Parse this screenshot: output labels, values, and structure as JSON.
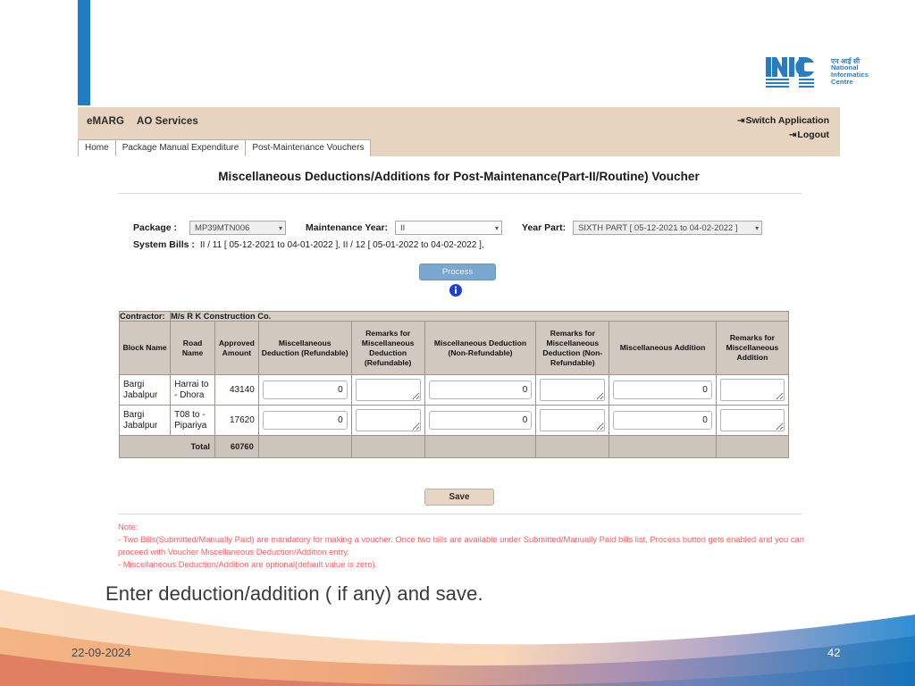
{
  "logo": {
    "mark": "NIC",
    "hindi": "एन आई सी",
    "line1": "National",
    "line2": "Informatics",
    "line3": "Centre"
  },
  "app": {
    "brand": "eMARG",
    "service": "AO Services",
    "switch_application": "Switch Application",
    "logout": "Logout",
    "tabs": [
      {
        "label": "Home"
      },
      {
        "label": "Package Manual Expenditure"
      },
      {
        "label": "Post-Maintenance Vouchers"
      }
    ]
  },
  "page": {
    "title": "Miscellaneous Deductions/Additions for Post-Maintenance(Part-II/Routine) Voucher"
  },
  "form": {
    "package_label": "Package :",
    "package_value": "MP39MTN006",
    "maintenance_year_label": "Maintenance Year:",
    "maintenance_year_value": "II",
    "year_part_label": "Year Part:",
    "year_part_value": "SIXTH PART [ 05-12-2021 to 04-02-2022 ]",
    "system_bills_label": "System Bills :",
    "system_bills_value": "II / 11 [ 05-12-2021 to 04-01-2022 ], II / 12 [ 05-01-2022 to 04-02-2022 ],",
    "process_label": "Process",
    "caret": "⌄"
  },
  "table": {
    "contractor_label": "Contractor:",
    "contractor_value": "M/s R K Construction Co.",
    "headers": [
      "Block Name",
      "Road Name",
      "Approved Amount",
      "Miscellaneous Deduction (Refundable)",
      "Remarks for Miscellaneous Deduction (Refundable)",
      "Miscellaneous Deduction (Non-Refundable)",
      "Remarks for Miscellaneous Deduction (Non-Refundable)",
      "Miscellaneous Addition",
      "Remarks for Miscellaneous Addition"
    ],
    "rows": [
      {
        "block_name": "Bargi Jabalpur",
        "road_name": "Harrai to - Dhora",
        "approved_amount": "43140",
        "deduction_refundable": "0",
        "remarks_deduction_refundable": "",
        "deduction_non_refundable": "0",
        "remarks_deduction_non_refundable": "",
        "addition": "0",
        "remarks_addition": ""
      },
      {
        "block_name": "Bargi Jabalpur",
        "road_name": "T08 to - Pipariya",
        "approved_amount": "17620",
        "deduction_refundable": "0",
        "remarks_deduction_refundable": "",
        "deduction_non_refundable": "0",
        "remarks_deduction_non_refundable": "",
        "addition": "0",
        "remarks_addition": ""
      }
    ],
    "total_label": "Total",
    "total_value": "60760",
    "save_label": "Save"
  },
  "note": {
    "heading": "Note:",
    "line1": "- Two Bills(Submitted/Manually Paid) are mandatory for making a voucher. Once two bills are available under Submitted/Manually Paid bills list, Process button gets enabled and you can proceed with Voucher Miscellaneous Deduction/Addition entry.",
    "line2": "- Miscellaneous Deduction/Addition are optional(default value is zero)."
  },
  "caption": "Enter deduction/addition ( if any) and save.",
  "footer": {
    "date": "22-09-2024",
    "page_number": "42"
  },
  "colors": {
    "accent_blue": "#1f7dc4",
    "header_beige": "#e6d3c0",
    "note_red": "#f2625f",
    "process_blue": "#7aa7cf",
    "save_tan": "#e8d5c3"
  }
}
